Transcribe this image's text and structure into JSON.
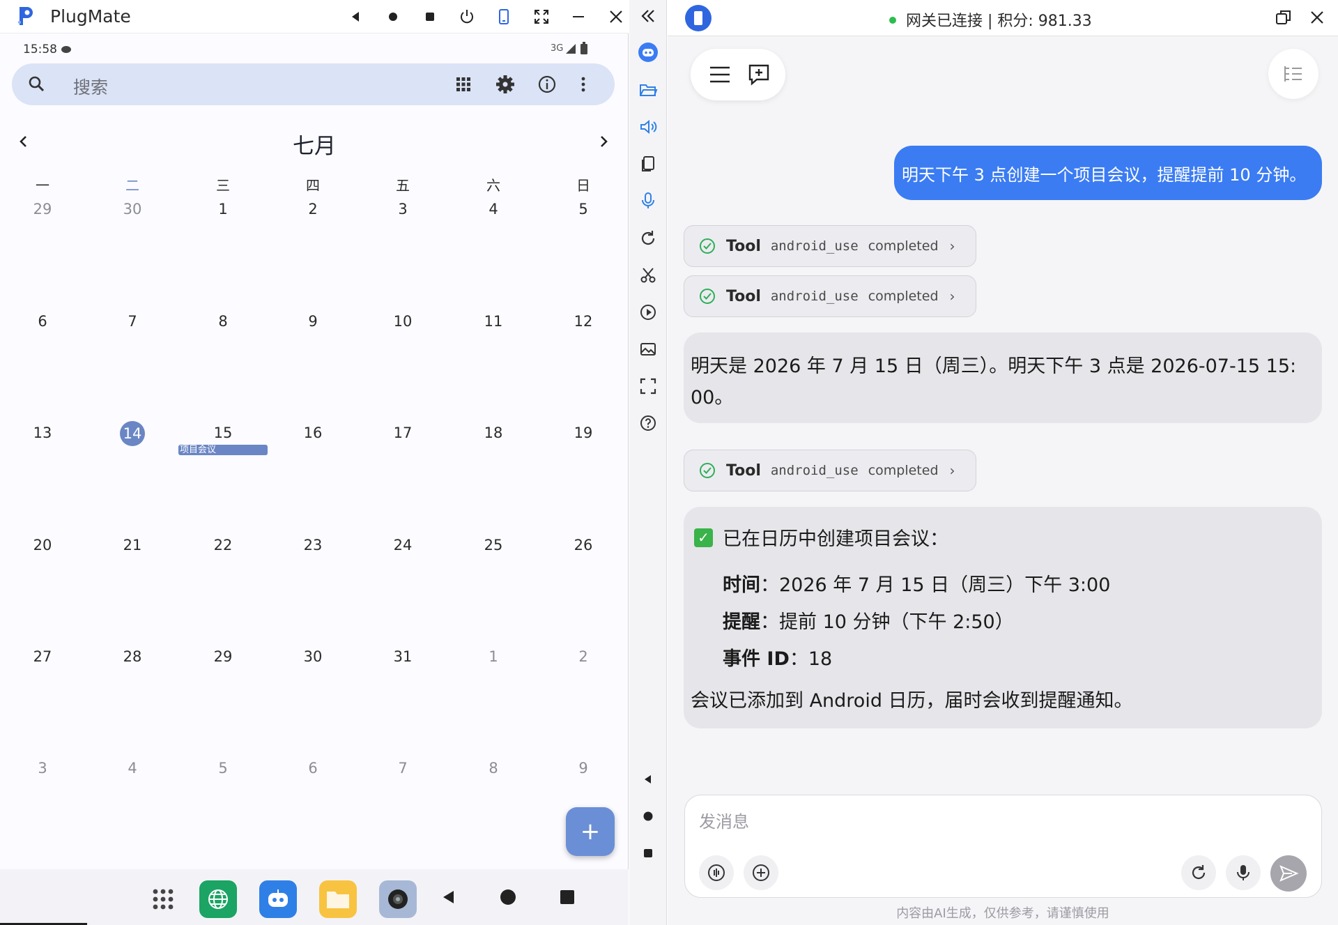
{
  "left_window": {
    "title": "PlugMate",
    "status_bar": {
      "time": "15:58",
      "network": "3G"
    },
    "search": {
      "placeholder": "搜索"
    },
    "calendar": {
      "month": "七月",
      "weekdays": [
        "一",
        "二",
        "三",
        "四",
        "五",
        "六",
        "日"
      ],
      "weeks": [
        [
          "29",
          "30",
          "1",
          "2",
          "3",
          "4",
          "5"
        ],
        [
          "6",
          "7",
          "8",
          "9",
          "10",
          "11",
          "12"
        ],
        [
          "13",
          "14",
          "15",
          "16",
          "17",
          "18",
          "19"
        ],
        [
          "20",
          "21",
          "22",
          "23",
          "24",
          "25",
          "26"
        ],
        [
          "27",
          "28",
          "29",
          "30",
          "31",
          "1",
          "2"
        ],
        [
          "3",
          "4",
          "5",
          "6",
          "7",
          "8",
          "9"
        ]
      ],
      "today": "14",
      "event": {
        "day": "15",
        "label": "项目会议"
      },
      "fab_label": "+"
    }
  },
  "right_panel": {
    "status": "网关已连接 | 积分: 981.33",
    "user_message": "明天下午 3 点创建一个项目会议，提醒提前 10 分钟。",
    "tool_calls": [
      {
        "label": "Tool",
        "name": "android_use",
        "status": "completed"
      },
      {
        "label": "Tool",
        "name": "android_use",
        "status": "completed"
      },
      {
        "label": "Tool",
        "name": "android_use",
        "status": "completed"
      }
    ],
    "assistant_message_1": {
      "line1": "明天是 2026 年 7 月 15 日（周三）。明天下午 3 点是 2026-07-15 15:",
      "line2": "00。"
    },
    "assistant_message_2": {
      "heading": "已在日历中创建项目会议：",
      "time_label": "时间",
      "time_value": "2026 年 7 月 15 日（周三）下午 3:00",
      "reminder_label": "提醒",
      "reminder_value": "提前 10 分钟（下午 2:50）",
      "event_id_label": "事件 ID",
      "event_id_value": "18",
      "footer": "会议已添加到 Android 日历，届时会收到提醒通知。"
    },
    "input": {
      "placeholder": "发消息"
    },
    "disclaimer": "内容由AI生成，仅供参考，请谨慎使用"
  },
  "colors": {
    "accent": "#3b7cf3",
    "calendar_accent": "#6a86c4",
    "connected": "#2dbd4e"
  }
}
